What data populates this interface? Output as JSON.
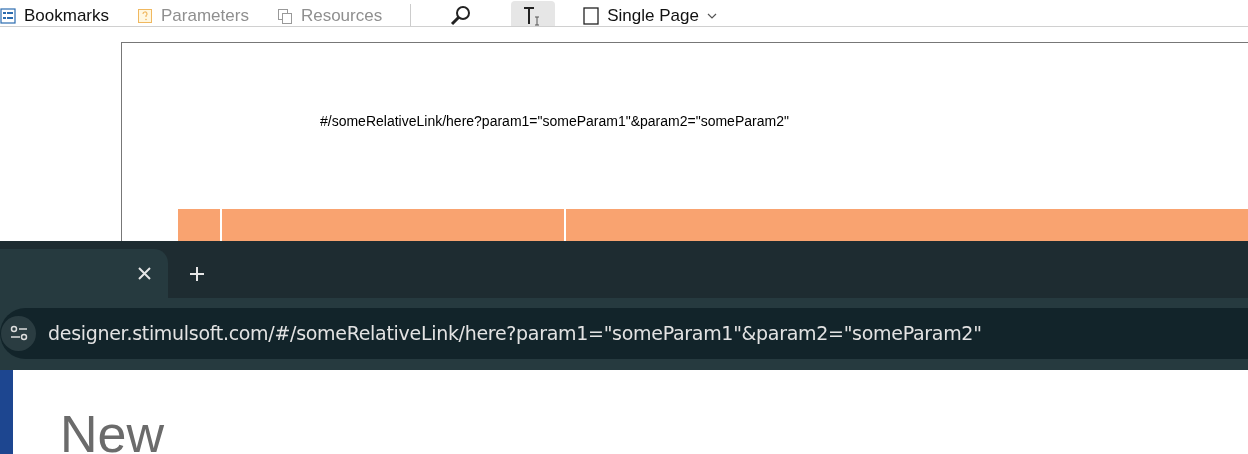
{
  "viewer_toolbar": {
    "items": [
      {
        "kind": "bookmarks",
        "label": "Bookmarks",
        "disabled": false
      },
      {
        "kind": "parameters",
        "label": "Parameters",
        "disabled": true
      },
      {
        "kind": "resources",
        "label": "Resources",
        "disabled": true
      }
    ],
    "tools": [
      {
        "kind": "find",
        "selected": false
      },
      {
        "kind": "select",
        "selected": true
      }
    ],
    "view_mode": {
      "label": "Single Page"
    }
  },
  "report": {
    "link_text": "#/someRelativeLink/here?param1=\"someParam1\"&param2=\"someParam2\""
  },
  "browser": {
    "address": "designer.stimulsoft.com/#/someRelativeLink/here?param1=\"someParam1\"&param2=\"someParam2\""
  },
  "page": {
    "heading": "New"
  }
}
